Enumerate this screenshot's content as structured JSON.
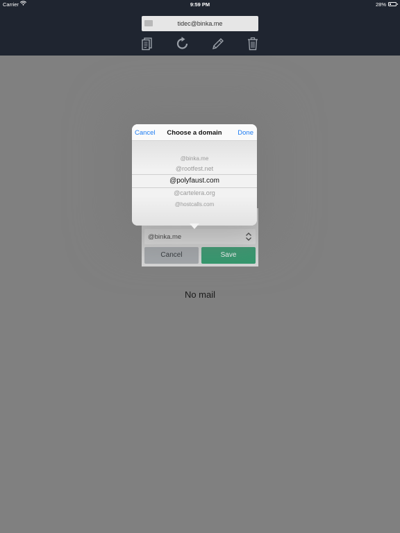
{
  "status_bar": {
    "carrier": "Carrier",
    "time": "9:59 PM",
    "battery_percent": "28%",
    "battery_level": 0.28
  },
  "header": {
    "address": "tidec@binka.me",
    "toolbar": [
      {
        "name": "copy-icon"
      },
      {
        "name": "refresh-icon"
      },
      {
        "name": "edit-icon"
      },
      {
        "name": "trash-icon"
      }
    ]
  },
  "domain_form": {
    "selected_domain": "@binka.me",
    "cancel_label": "Cancel",
    "save_label": "Save"
  },
  "picker": {
    "cancel_label": "Cancel",
    "title": "Choose a domain",
    "done_label": "Done",
    "options": [
      "@binka.me",
      "@rootfest.net",
      "@polyfaust.com",
      "@cartelera.org",
      "@hostcalls.com"
    ],
    "selected_index": 2
  },
  "main": {
    "empty_message": "No mail"
  },
  "colors": {
    "header_bg": "#1f2530",
    "link_blue": "#1d7cf2",
    "save_green": "#2e9a6c",
    "overlay_gray": "#808080"
  }
}
